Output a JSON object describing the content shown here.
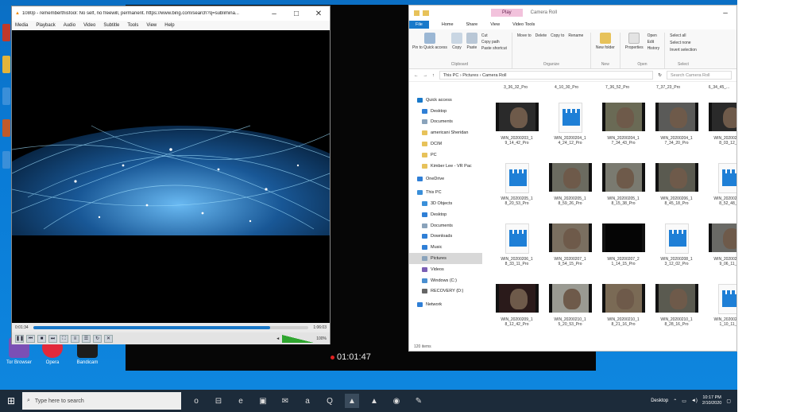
{
  "background_player": {
    "time": "01:01:47"
  },
  "desktop_icons": [
    {
      "label": "Tor Browser",
      "color": "#7b4fb5"
    },
    {
      "label": "Opera",
      "color": "#e2293b"
    },
    {
      "label": "Bandicam",
      "color": "#1d1d1d"
    }
  ],
  "vlc": {
    "title": "1080p - rememberthisfool: No self, no freewill, permanent. https://www.bing.com/search?q=sublimina...",
    "menu": [
      "Media",
      "Playback",
      "Audio",
      "Video",
      "Subtitle",
      "Tools",
      "View",
      "Help"
    ],
    "elapsed": "0:01:34",
    "remaining": "1:06:03",
    "progress": 0.86,
    "volume": "100%"
  },
  "explorer": {
    "play_tab": "Play",
    "location_title": "Camera Roll",
    "tabs": [
      "File",
      "Home",
      "Share",
      "View",
      "Video Tools"
    ],
    "ribbon_groups": [
      {
        "label": "Clipboard",
        "items": [
          "Pin to Quick access",
          "Copy",
          "Paste"
        ],
        "small": [
          "Cut",
          "Copy path",
          "Paste shortcut"
        ]
      },
      {
        "label": "Organize",
        "items": [
          "Move to",
          "Copy to",
          "Delete",
          "Rename"
        ]
      },
      {
        "label": "New",
        "items": [
          "New folder"
        ]
      },
      {
        "label": "Open",
        "items": [
          "Properties",
          "Open",
          "Edit",
          "History"
        ]
      },
      {
        "label": "Select",
        "items": [
          "Select all",
          "Select none",
          "Invert selection"
        ]
      }
    ],
    "breadcrumb": [
      "This PC",
      "Pictures",
      "Camera Roll"
    ],
    "search_placeholder": "Search Camera Roll",
    "nav": [
      {
        "label": "Quick access",
        "color": "#1979ca"
      },
      {
        "label": "Desktop",
        "color": "#2f7fd6"
      },
      {
        "label": "Documents",
        "color": "#8aa3bb"
      },
      {
        "label": "americani Sheridan",
        "color": "#e7c25a"
      },
      {
        "label": "DCIM",
        "color": "#e7c25a"
      },
      {
        "label": "PC",
        "color": "#e7c25a"
      },
      {
        "label": "Kimber Lee - VR Pac",
        "color": "#e7c25a"
      },
      {
        "label": "OneDrive",
        "color": "#2f7fd6"
      },
      {
        "label": "This PC",
        "color": "#3a8fd9"
      },
      {
        "label": "3D Objects",
        "color": "#3a8fd9"
      },
      {
        "label": "Desktop",
        "color": "#2f7fd6"
      },
      {
        "label": "Documents",
        "color": "#8aa3bb"
      },
      {
        "label": "Downloads",
        "color": "#2f7fd6"
      },
      {
        "label": "Music",
        "color": "#2f7fd6"
      },
      {
        "label": "Pictures",
        "color": "#8aa3bb"
      },
      {
        "label": "Videos",
        "color": "#7b5fb5"
      },
      {
        "label": "Windows (C:)",
        "color": "#4a8fd0"
      },
      {
        "label": "RECOVERY (D:)",
        "color": "#666666"
      },
      {
        "label": "Network",
        "color": "#2f7fd6"
      }
    ],
    "top_row_captions": [
      "3_36_32_Pro",
      "4_10_30_Pro",
      "7_36_52_Pro",
      "7_37_23_Pro",
      "6_34_45_..."
    ],
    "files": [
      {
        "name": "WIN_20200203_1 9_14_42_Pro",
        "kind": "video",
        "tone": "#2a2a2a"
      },
      {
        "name": "WIN_20200204_1 4_24_12_Pro",
        "kind": "clip"
      },
      {
        "name": "WIN_20200204_1 7_34_43_Pro",
        "kind": "video",
        "tone": "#6a6a55"
      },
      {
        "name": "WIN_20200204_1 7_34_20_Pro",
        "kind": "video",
        "tone": "#5a5a58"
      },
      {
        "name": "WIN_20200205_1 8_03_12_...",
        "kind": "video",
        "tone": "#2a2a2a"
      },
      {
        "name": "WIN_20200205_1 8_20_53_Pro",
        "kind": "clip"
      },
      {
        "name": "WIN_20200205_1 8_59_26_Pro",
        "kind": "video",
        "tone": "#6b6b60"
      },
      {
        "name": "WIN_20200205_1 8_15_38_Pro",
        "kind": "video",
        "tone": "#7a7a70"
      },
      {
        "name": "WIN_20200206_1 8_45_18_Pro",
        "kind": "video",
        "tone": "#5a5a50"
      },
      {
        "name": "WIN_20200206_1 8_52_48_...",
        "kind": "clip"
      },
      {
        "name": "WIN_20200206_1 8_33_11_Pro",
        "kind": "clip"
      },
      {
        "name": "WIN_20200207_1 9_54_15_Pro",
        "kind": "video",
        "tone": "#7a6f60"
      },
      {
        "name": "WIN_20200207_2 1_14_15_Pro",
        "kind": "video",
        "tone": "#050505"
      },
      {
        "name": "WIN_20200208_1 3_12_02_Pro",
        "kind": "clip"
      },
      {
        "name": "WIN_20200208_1 9_06_11_...",
        "kind": "video",
        "tone": "#6a6a66"
      },
      {
        "name": "WIN_20200209_1 8_12_42_Pro",
        "kind": "video",
        "tone": "#2a1a1a"
      },
      {
        "name": "WIN_20200210_1 5_20_53_Pro",
        "kind": "video",
        "tone": "#9a9a92"
      },
      {
        "name": "WIN_20200210_1 8_21_16_Pro",
        "kind": "video",
        "tone": "#7a6a55"
      },
      {
        "name": "WIN_20200210_1 8_28_16_Pro",
        "kind": "video",
        "tone": "#5a5a50"
      },
      {
        "name": "WIN_20200211_1 1_10_11_...",
        "kind": "clip"
      }
    ],
    "status": "120 items"
  },
  "taskbar": {
    "search_placeholder": "Type here to search",
    "apps": [
      "o",
      "⊟",
      "e",
      "▣",
      "✉",
      "a",
      "Q",
      "▲",
      "▲",
      "◉",
      "✎"
    ],
    "tray_label": "Desktop",
    "time": "10:17 PM",
    "date": "2/10/2020"
  },
  "colors": {
    "accent": "#1979ca",
    "taskbar": "#1c2b3a",
    "desktop": "#0b6fc4"
  }
}
